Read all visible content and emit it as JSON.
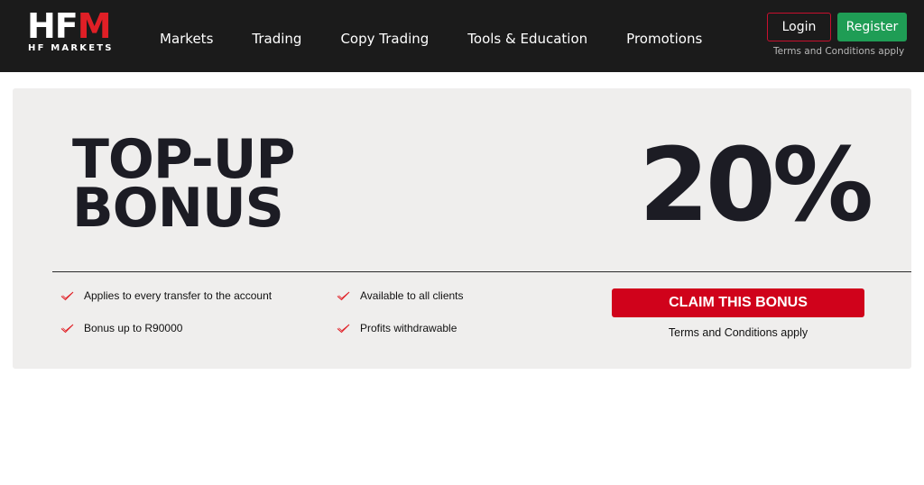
{
  "header": {
    "logo": {
      "mark_text": "HF",
      "mark_accent": "M",
      "subtitle": "HF MARKETS"
    },
    "nav": [
      {
        "label": "Markets"
      },
      {
        "label": "Trading"
      },
      {
        "label": "Copy Trading"
      },
      {
        "label": "Tools & Education"
      },
      {
        "label": "Promotions"
      }
    ],
    "login_label": "Login",
    "register_label": "Register",
    "terms_text": "Terms and Conditions apply"
  },
  "banner": {
    "headline_line1": "TOP-UP",
    "headline_line2": "BONUS",
    "percent": "20%",
    "features": [
      {
        "icon": "check-icon",
        "label": "Applies to every transfer to the account"
      },
      {
        "icon": "check-icon",
        "label": "Available to all clients"
      },
      {
        "icon": "check-icon",
        "label": "Bonus up to R90000"
      },
      {
        "icon": "check-icon",
        "label": "Profits withdrawable"
      }
    ],
    "claim_label": "CLAIM THIS BONUS",
    "terms_text": "Terms and Conditions apply"
  },
  "colors": {
    "header_bg": "#1b1b1b",
    "brand_red": "#e01f26",
    "claim_red": "#d0021b",
    "register_green": "#1f9d55",
    "banner_bg": "#efeeed"
  }
}
